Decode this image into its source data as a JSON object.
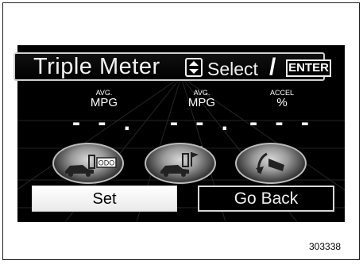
{
  "header": {
    "title": "Triple Meter",
    "select_label": "Select",
    "slash": "/",
    "enter_label": "ENTER"
  },
  "meters": [
    {
      "top_label": "AVG.",
      "main_label": "MPG",
      "value": "- - . -",
      "icon": "car-fuel-odo-icon",
      "icon_text": "ODO"
    },
    {
      "top_label": "AVG.",
      "main_label": "MPG",
      "value": "- - . -",
      "icon": "car-fuel-flag-icon"
    },
    {
      "top_label": "ACCEL",
      "main_label": "%",
      "value": "- - -",
      "icon": "accelerator-pedal-icon"
    }
  ],
  "buttons": {
    "set_label": "Set",
    "back_label": "Go Back"
  },
  "figure_number": "303338",
  "colors": {
    "screen_bg": "#000000",
    "text": "#ffffff",
    "button_light": "#f2f2f2"
  }
}
